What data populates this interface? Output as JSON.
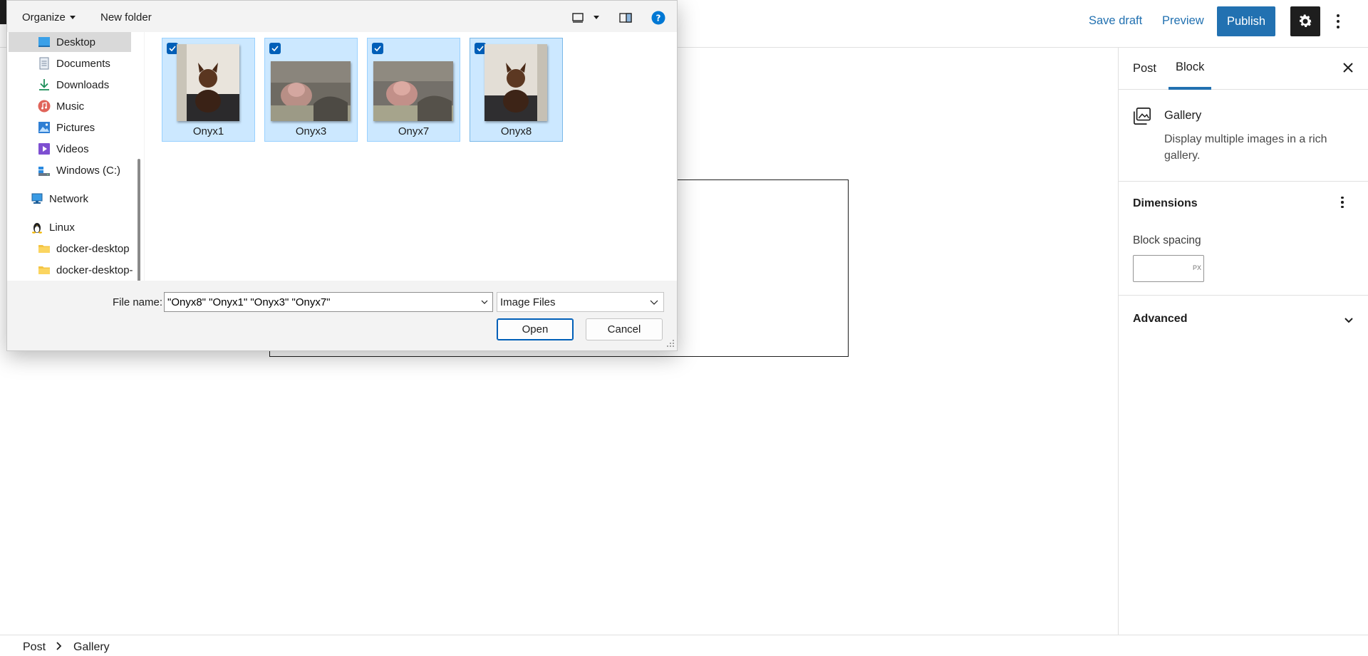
{
  "header": {
    "save_draft": "Save draft",
    "preview": "Preview",
    "publish": "Publish",
    "settings_icon": "gear-icon",
    "options_icon": "vertical-ellipsis-icon"
  },
  "sidebar": {
    "tabs": [
      {
        "label": "Post",
        "active": false
      },
      {
        "label": "Block",
        "active": true
      }
    ],
    "block": {
      "title": "Gallery",
      "description": "Display multiple images in a rich gallery.",
      "icon": "gallery-icon"
    },
    "dimensions": {
      "title": "Dimensions",
      "block_spacing_label": "Block spacing",
      "block_spacing_value": "",
      "unit": "PX"
    },
    "advanced": {
      "title": "Advanced"
    }
  },
  "breadcrumb": [
    "Post",
    "Gallery"
  ],
  "dialog": {
    "toolbar": {
      "organize": "Organize",
      "new_folder": "New folder"
    },
    "nav": [
      {
        "label": "Desktop",
        "icon": "desktop-icon",
        "selected": true
      },
      {
        "label": "Documents",
        "icon": "documents-icon",
        "selected": false
      },
      {
        "label": "Downloads",
        "icon": "downloads-icon",
        "selected": false
      },
      {
        "label": "Music",
        "icon": "music-icon",
        "selected": false
      },
      {
        "label": "Pictures",
        "icon": "pictures-icon",
        "selected": false
      },
      {
        "label": "Videos",
        "icon": "videos-icon",
        "selected": false
      },
      {
        "label": "Windows (C:)",
        "icon": "drive-icon",
        "selected": false
      },
      {
        "label": "Network",
        "icon": "network-icon",
        "selected": false
      },
      {
        "label": "Linux",
        "icon": "linux-icon",
        "selected": false
      },
      {
        "label": "docker-desktop",
        "icon": "folder-icon",
        "selected": false
      },
      {
        "label": "docker-desktop-",
        "icon": "folder-icon",
        "selected": false
      }
    ],
    "files": [
      {
        "name": "Onyx1",
        "checked": true
      },
      {
        "name": "Onyx3",
        "checked": true
      },
      {
        "name": "Onyx7",
        "checked": true
      },
      {
        "name": "Onyx8",
        "checked": true
      }
    ],
    "file_name_label": "File name:",
    "file_name_value": "\"Onyx8\" \"Onyx1\" \"Onyx3\" \"Onyx7\"",
    "file_type": "Image Files",
    "open_button": "Open",
    "cancel_button": "Cancel"
  },
  "colors": {
    "wp_accent": "#2271b1",
    "dialog_selection": "#cce8ff",
    "dialog_accent": "#005fb8"
  }
}
